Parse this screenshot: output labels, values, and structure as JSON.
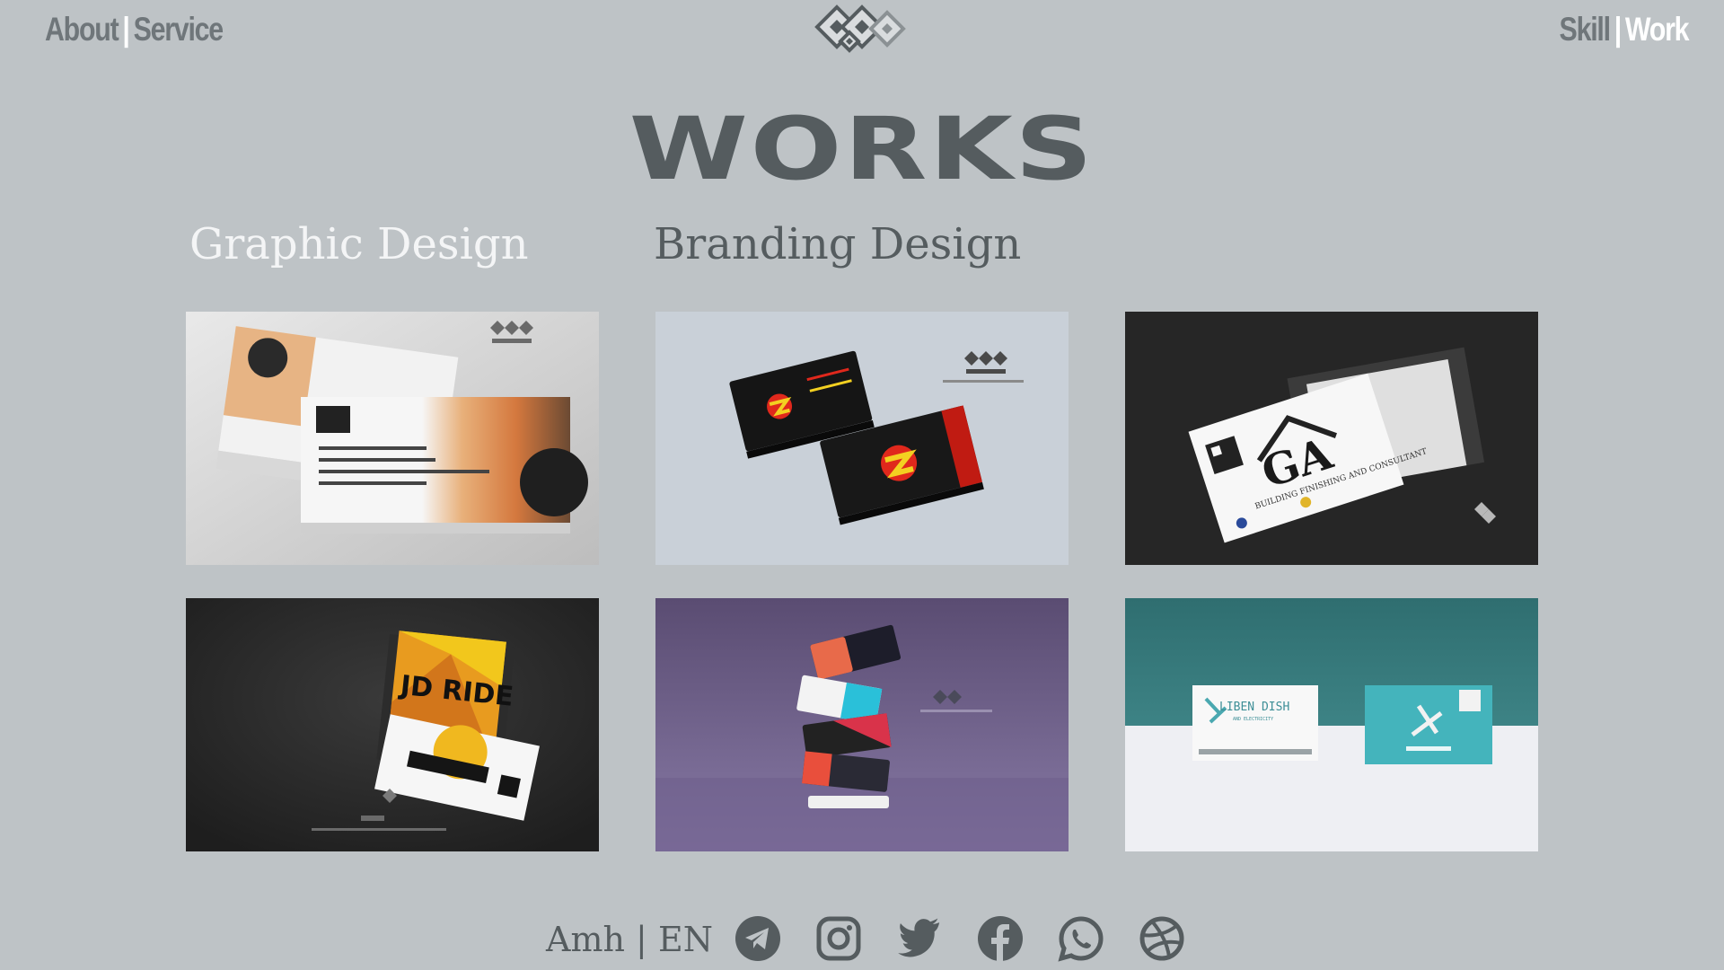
{
  "nav": {
    "left": [
      {
        "label": "About"
      },
      {
        "label": "Service"
      }
    ],
    "right": [
      {
        "label": "Skill"
      },
      {
        "label": "Work"
      }
    ],
    "separator": "|"
  },
  "title": "WORKS",
  "tabs": [
    {
      "label": "Graphic Design",
      "active": true
    },
    {
      "label": "Branding Design",
      "active": false
    }
  ],
  "gallery": {
    "items": [
      {
        "name": "afro business card"
      },
      {
        "name": "black red business card"
      },
      {
        "name": "GA building finishing business card",
        "brand": "GA",
        "subtitle": "BUILDING FINISHING AND CONSULTANT"
      },
      {
        "name": "JD Ride business card",
        "brand": "JD RIDE"
      },
      {
        "name": "floating stacked business cards"
      },
      {
        "name": "Liben Dish business card",
        "brand": "LIBEN DISH",
        "subtitle": "AND ELECTRICITY"
      }
    ]
  },
  "footer": {
    "lang": {
      "amh": "Amh",
      "sep": "|",
      "en": "EN"
    },
    "socials": [
      {
        "icon": "telegram-icon"
      },
      {
        "icon": "instagram-icon"
      },
      {
        "icon": "twitter-icon"
      },
      {
        "icon": "facebook-icon"
      },
      {
        "icon": "whatsapp-icon"
      },
      {
        "icon": "dribbble-icon"
      }
    ]
  },
  "colors": {
    "background": "#bec3c6",
    "title": "#555c5f",
    "nav": "#6f767a",
    "active": "#ffffff"
  }
}
